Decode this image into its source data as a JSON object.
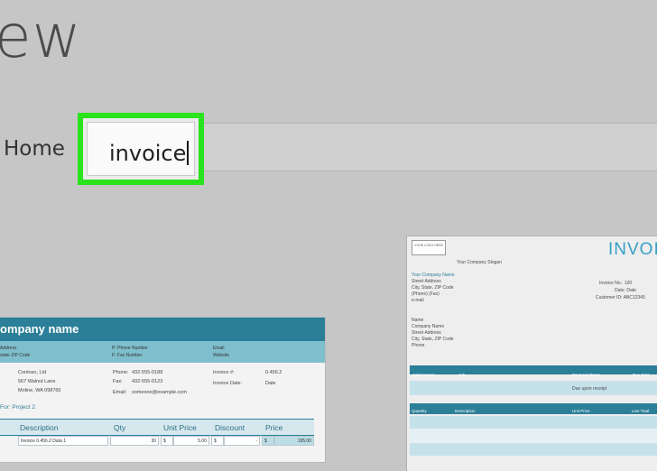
{
  "page": {
    "title_fragment": "ew",
    "home_label": "Home"
  },
  "search": {
    "value": "invoice",
    "highlight_color": "#29e31c"
  },
  "template_1": {
    "company": "ompany name",
    "band_left": [
      "Address",
      "state ZIP Code"
    ],
    "band_mid": [
      "P: Phone Number",
      "F: Fax Number"
    ],
    "band_right": [
      "Email",
      "Website"
    ],
    "bill_to": [
      "Contoso, Ltd",
      "567 Walnut Lane",
      "Moline, WA 098765"
    ],
    "phone_label": "Phone:",
    "phone_value": "432-555-0188",
    "fax_label": "Fax:",
    "fax_value": "432-555-0123",
    "email_label": "Email:",
    "email_value": "someone@example.com",
    "invoice_label": "Invoice #:",
    "invoice_value": "0.456.2",
    "date_label": "Invoice Date:",
    "date_value": "Date",
    "project": "For: Project 2",
    "columns": [
      "Description",
      "Qty",
      "Unit Price",
      "Discount",
      "Price"
    ],
    "row": {
      "description": "Invoice 0.456.2 Data 1",
      "qty": "30",
      "unit_currency": "$",
      "unit": "5.00",
      "discount_currency": "$",
      "discount": "-",
      "price_currency": "$",
      "price": "195.00"
    }
  },
  "template_2": {
    "logo": "YOUR LOGO HERE",
    "title": "INVOICE",
    "slogan": "Your Company Slogan",
    "company_lines": [
      "Your Company Name",
      "Street Address",
      "City, State, ZIP Code",
      "(Phone) (Fax)",
      "e-mail"
    ],
    "meta_lines": [
      "Invoice No.: 100",
      "Date: Date",
      "Customer ID: ABC12345"
    ],
    "to_lines": [
      "Name",
      "Company Name",
      "Street Address",
      "City, State, ZIP Code",
      "Phone"
    ],
    "bar1": [
      "Salesperson",
      "Job",
      "Payment Terms",
      "Due Date"
    ],
    "due_text": "Due upon receipt",
    "bar2": [
      "Quantity",
      "Description",
      "Unit Price",
      "Line Total"
    ]
  }
}
